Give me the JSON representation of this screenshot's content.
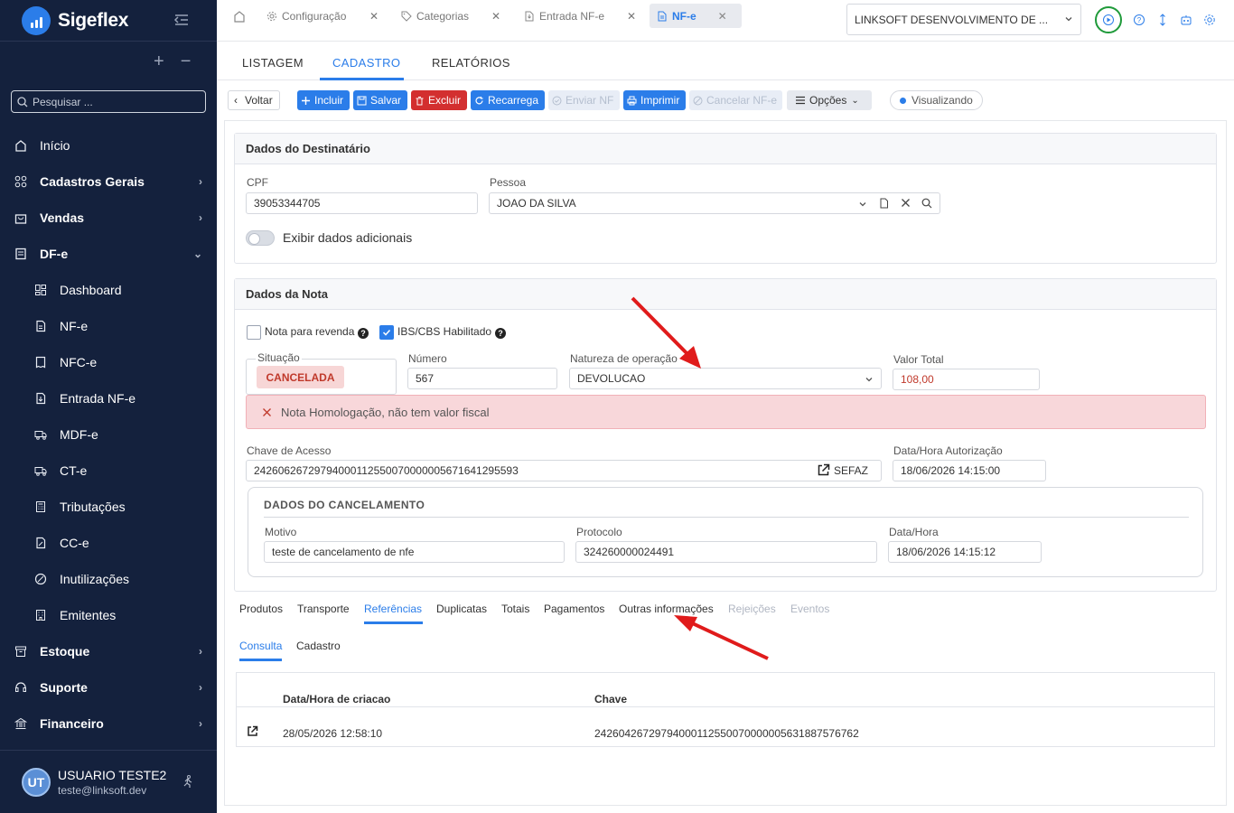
{
  "app": {
    "name": "Sigeflex"
  },
  "sidebar": {
    "search_placeholder": "Pesquisar ...",
    "actions": {
      "add": "+",
      "remove": "−"
    },
    "items": [
      {
        "label": "Início"
      },
      {
        "label": "Cadastros Gerais"
      },
      {
        "label": "Vendas"
      },
      {
        "label": "DF-e"
      },
      {
        "label": "Dashboard"
      },
      {
        "label": "NF-e"
      },
      {
        "label": "NFC-e"
      },
      {
        "label": "Entrada NF-e"
      },
      {
        "label": "MDF-e"
      },
      {
        "label": "CT-e"
      },
      {
        "label": "Tributações"
      },
      {
        "label": "CC-e"
      },
      {
        "label": "Inutilizações"
      },
      {
        "label": "Emitentes"
      },
      {
        "label": "Estoque"
      },
      {
        "label": "Suporte"
      },
      {
        "label": "Financeiro"
      }
    ],
    "user": {
      "initials": "UT",
      "name": "USUARIO TESTE2",
      "email": "teste@linksoft.dev"
    }
  },
  "topbar": {
    "tabs": [
      {
        "label": "Configuração"
      },
      {
        "label": "Categorias"
      },
      {
        "label": "Entrada NF-e"
      },
      {
        "label": "NF-e"
      }
    ],
    "company": "LINKSOFT DESENVOLVIMENTO DE ..."
  },
  "page_tabs": [
    "LISTAGEM",
    "CADASTRO",
    "RELATÓRIOS"
  ],
  "toolbar": {
    "voltar": "Voltar",
    "incluir": "Incluir",
    "salvar": "Salvar",
    "excluir": "Excluir",
    "recarrega": "Recarrega",
    "enviar_nf": "Enviar NF",
    "imprimir": "Imprimir",
    "cancelar_nfe": "Cancelar NF-e",
    "opcoes": "Opções",
    "status": "Visualizando"
  },
  "destinatario": {
    "title": "Dados do Destinatário",
    "cpf_label": "CPF",
    "cpf": "39053344705",
    "pessoa_label": "Pessoa",
    "pessoa": "JOAO DA SILVA",
    "exibir_label": "Exibir dados adicionais"
  },
  "nota": {
    "title": "Dados da Nota",
    "revenda_label": "Nota para revenda",
    "ibs_label": "IBS/CBS Habilitado",
    "situacao_label": "Situação",
    "situacao": "CANCELADA",
    "numero_label": "Número",
    "numero": "567",
    "natureza_label": "Natureza de operação",
    "natureza": "DEVOLUCAO",
    "valor_label": "Valor Total",
    "valor": "108,00",
    "alert": "Nota Homologação, não tem valor fiscal",
    "chave_label": "Chave de Acesso",
    "chave": "24260626729794000112550070000005671641295593",
    "sefaz": "SEFAZ",
    "data_aut_label": "Data/Hora Autorização",
    "data_aut": "18/06/2026 14:15:00",
    "cancelamento": {
      "title": "DADOS DO CANCELAMENTO",
      "motivo_label": "Motivo",
      "motivo": "teste de cancelamento de nfe",
      "protocolo_label": "Protocolo",
      "protocolo": "324260000024491",
      "datahora_label": "Data/Hora",
      "datahora": "18/06/2026 14:15:12"
    }
  },
  "detail_tabs": [
    "Produtos",
    "Transporte",
    "Referências",
    "Duplicatas",
    "Totais",
    "Pagamentos",
    "Outras informações",
    "Rejeições",
    "Eventos"
  ],
  "sub_tabs": [
    "Consulta",
    "Cadastro"
  ],
  "table": {
    "headers": [
      "Data/Hora de criacao",
      "Chave"
    ],
    "rows": [
      {
        "data": "28/05/2026 12:58:10",
        "chave": "24260426729794000112550070000005631887576762"
      }
    ]
  },
  "colors": {
    "sidebar": "#14213d",
    "accent": "#2b7de9",
    "danger": "#d32f2f",
    "annotation": "#e01b1b"
  }
}
